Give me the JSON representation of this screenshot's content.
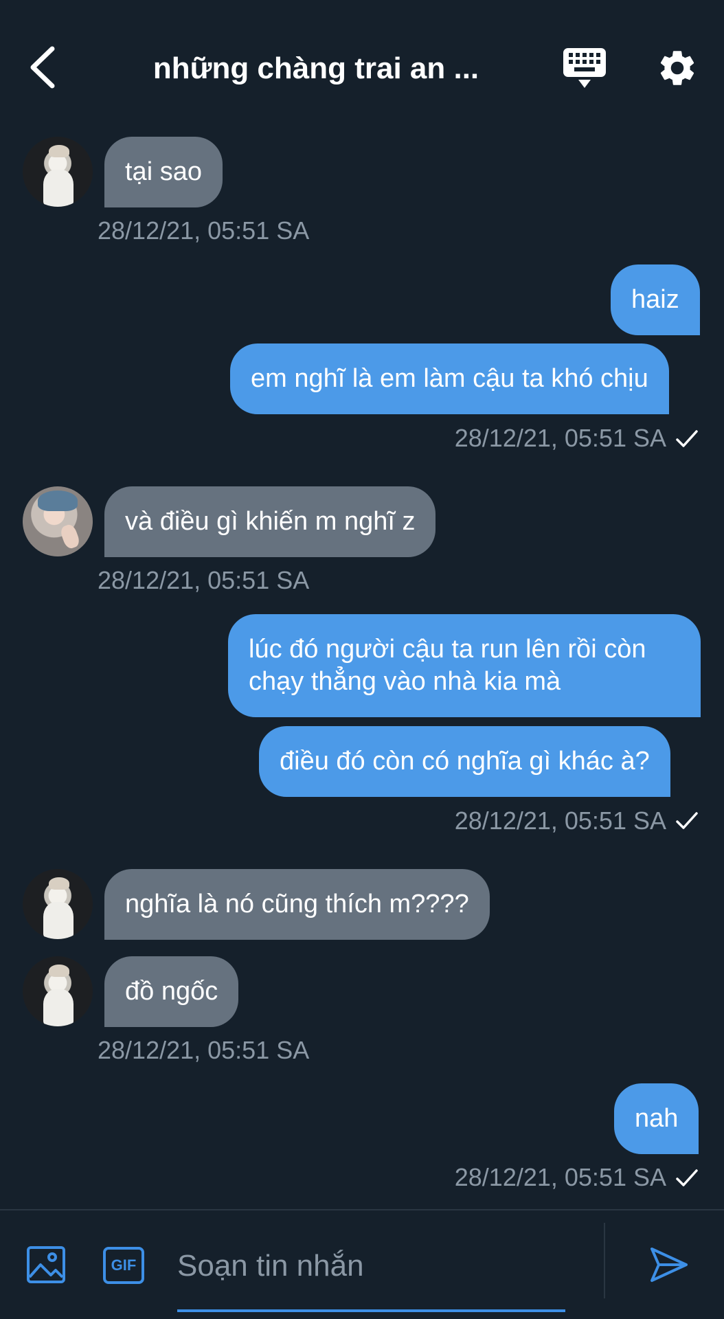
{
  "header": {
    "title": "những chàng trai an ...",
    "back_icon": "chevron-left-icon",
    "keyboard_icon": "keyboard-icon",
    "settings_icon": "gear-icon"
  },
  "messages": [
    {
      "dir": "in",
      "text": "tại sao",
      "timestamp": "28/12/21, 05:51 SA"
    },
    {
      "dir": "out",
      "text": "haiz"
    },
    {
      "dir": "out",
      "text": "em nghĩ là em làm cậu ta khó chịu",
      "timestamp": "28/12/21, 05:51 SA"
    },
    {
      "dir": "in",
      "text": "và điều gì khiến m nghĩ z",
      "timestamp": "28/12/21, 05:51 SA"
    },
    {
      "dir": "out",
      "text": "lúc đó người cậu ta run lên rồi còn chạy thẳng vào nhà kia mà"
    },
    {
      "dir": "out",
      "text": "điều đó còn có nghĩa gì khác à?",
      "timestamp": "28/12/21, 05:51 SA"
    },
    {
      "dir": "in",
      "text": "nghĩa là nó cũng thích m????"
    },
    {
      "dir": "in",
      "text": "đồ ngốc",
      "timestamp": "28/12/21, 05:51 SA"
    },
    {
      "dir": "out",
      "text": "nah",
      "timestamp": "28/12/21, 05:51 SA"
    }
  ],
  "composer": {
    "placeholder": "Soạn tin nhắn",
    "value": "",
    "gif_label": "GIF",
    "image_icon": "image-icon",
    "send_icon": "send-icon"
  },
  "colors": {
    "background": "#15202b",
    "incoming_bubble": "#66727f",
    "outgoing_bubble": "#4c9ae8",
    "timestamp": "#8b98a5",
    "accent": "#3d8fe6"
  }
}
